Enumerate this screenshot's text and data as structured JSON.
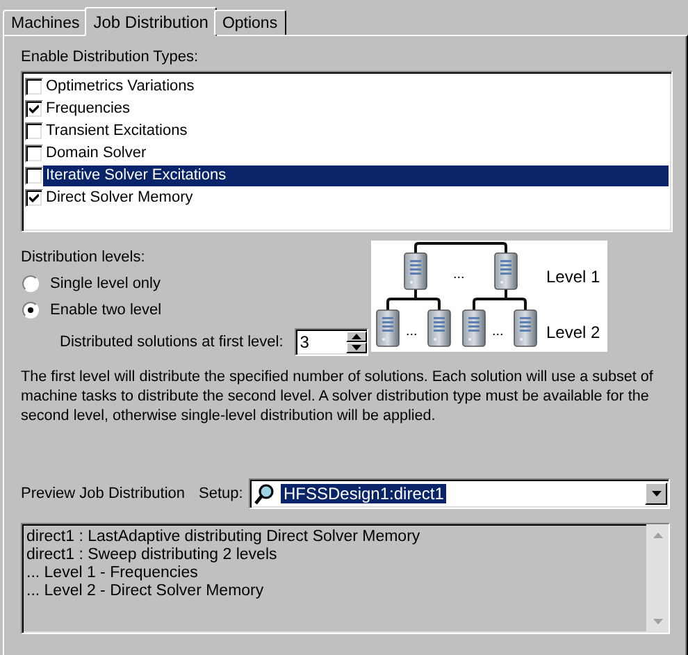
{
  "tabs": [
    {
      "label": "Machines",
      "selected": false
    },
    {
      "label": "Job Distribution",
      "selected": true
    },
    {
      "label": "Options",
      "selected": false
    }
  ],
  "types": {
    "label": "Enable Distribution Types:",
    "items": [
      {
        "label": "Optimetrics Variations",
        "checked": false,
        "selected": false
      },
      {
        "label": "Frequencies",
        "checked": true,
        "selected": false
      },
      {
        "label": "Transient Excitations",
        "checked": false,
        "selected": false
      },
      {
        "label": "Domain Solver",
        "checked": false,
        "selected": false
      },
      {
        "label": "Iterative Solver Excitations",
        "checked": false,
        "selected": true
      },
      {
        "label": "Direct Solver Memory",
        "checked": true,
        "selected": false
      }
    ]
  },
  "levels": {
    "label": "Distribution levels:",
    "options": [
      {
        "label": "Single level only",
        "selected": false
      },
      {
        "label": "Enable two level",
        "selected": true
      }
    ],
    "spinner": {
      "label": "Distributed solutions at first level:",
      "value": "3"
    }
  },
  "diagram": {
    "ellipses": [
      "...",
      "...",
      "..."
    ],
    "level_labels": [
      "Level 1",
      "Level 2"
    ]
  },
  "note": "The first level will distribute the specified number of solutions. Each solution will use a subset of machine tasks to distribute the second level. A solver distribution type must be available for the second level, otherwise single-level distribution will be applied.",
  "preview": {
    "label": "Preview Job Distribution",
    "setup_label": "Setup:",
    "setup_value": "HFSSDesign1:direct1",
    "lines": [
      "direct1 : LastAdaptive distributing Direct Solver Memory",
      "direct1 : Sweep distributing 2 levels",
      "... Level 1 - Frequencies",
      "... Level 2 - Direct Solver Memory"
    ]
  }
}
